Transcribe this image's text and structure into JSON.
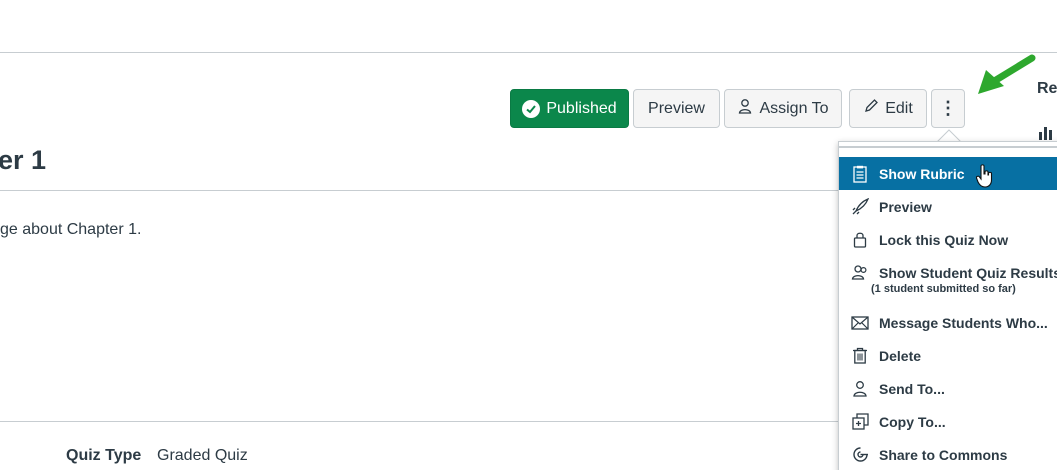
{
  "header": {
    "published_label": "Published",
    "preview_label": "Preview",
    "assign_label": "Assign To",
    "edit_label": "Edit",
    "more_label": "⋮"
  },
  "sidebar_peek": {
    "label": "Rel"
  },
  "quiz": {
    "title": "er 1",
    "description": "ge about Chapter 1.",
    "type_label": "Quiz Type",
    "type_value": "Graded Quiz"
  },
  "menu": {
    "items": [
      {
        "label": "Show Rubric",
        "icon": "rubric-icon",
        "active": true
      },
      {
        "label": "Preview",
        "icon": "rocket-icon"
      },
      {
        "label": "Lock this Quiz Now",
        "icon": "lock-icon"
      },
      {
        "label": "Show Student Quiz Results",
        "icon": "users-icon",
        "sub": "(1 student submitted so far)"
      },
      {
        "label": "Message Students Who...",
        "icon": "envelope-icon"
      },
      {
        "label": "Delete",
        "icon": "trash-icon"
      },
      {
        "label": "Send To...",
        "icon": "user-icon"
      },
      {
        "label": "Copy To...",
        "icon": "copy-icon"
      },
      {
        "label": "Share to Commons",
        "icon": "commons-icon"
      }
    ]
  },
  "colors": {
    "published_green": "#0b874b",
    "menu_active_blue": "#0770a3",
    "arrow_green": "#2ea82e",
    "text": "#2d3b45"
  }
}
